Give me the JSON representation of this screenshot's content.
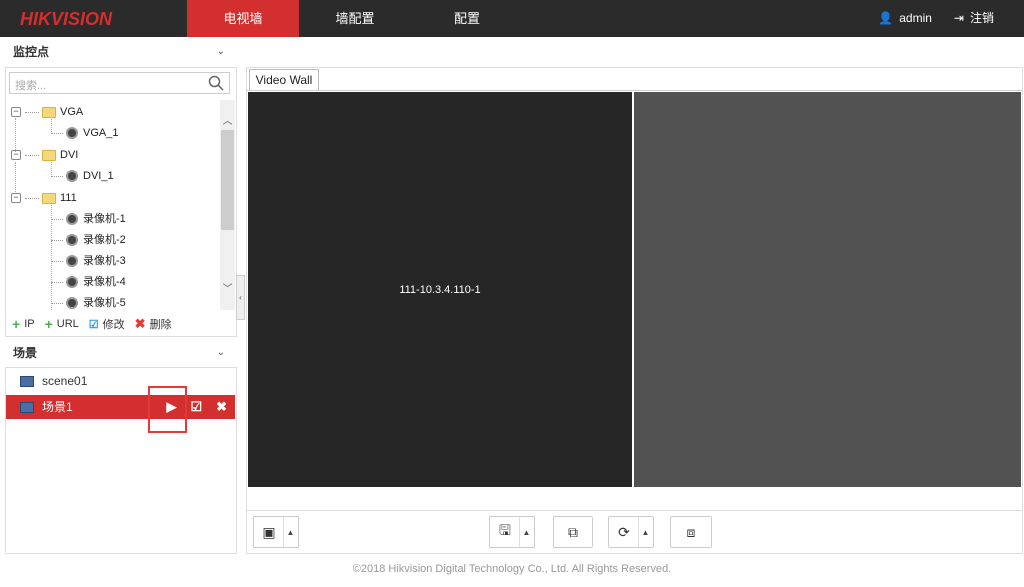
{
  "header": {
    "logo": "HIKVISION",
    "tabs": [
      {
        "label": "电视墙",
        "active": true
      },
      {
        "label": "墙配置"
      },
      {
        "label": "配置"
      }
    ],
    "user": "admin",
    "logout": "注销"
  },
  "monitor": {
    "title": "监控点",
    "search_placeholder": "搜索...",
    "tree": [
      {
        "label": "VGA",
        "type": "folder"
      },
      {
        "label": "VGA_1",
        "type": "camera"
      },
      {
        "label": "DVI",
        "type": "folder"
      },
      {
        "label": "DVI_1",
        "type": "camera"
      },
      {
        "label": "111",
        "type": "folder"
      },
      {
        "label": "录像机-1",
        "type": "camera"
      },
      {
        "label": "录像机-2",
        "type": "camera"
      },
      {
        "label": "录像机-3",
        "type": "camera"
      },
      {
        "label": "录像机-4",
        "type": "camera"
      },
      {
        "label": "录像机-5",
        "type": "camera"
      }
    ],
    "actions": {
      "ip": "IP",
      "url": "URL",
      "edit": "修改",
      "delete": "删除"
    }
  },
  "scenes": {
    "title": "场景",
    "items": [
      {
        "label": "scene01"
      },
      {
        "label": "场景1",
        "selected": true
      }
    ]
  },
  "main": {
    "tab": "Video Wall",
    "screens": [
      {
        "label": "111-10.3.4.110-1"
      },
      {
        "label": ""
      }
    ]
  },
  "footer": "©2018 Hikvision Digital Technology Co., Ltd. All Rights Reserved.",
  "colors": {
    "accent": "#d32f2f",
    "topbar": "#2b2b2b",
    "screen_active": "#262626",
    "screen_idle": "#525252"
  }
}
